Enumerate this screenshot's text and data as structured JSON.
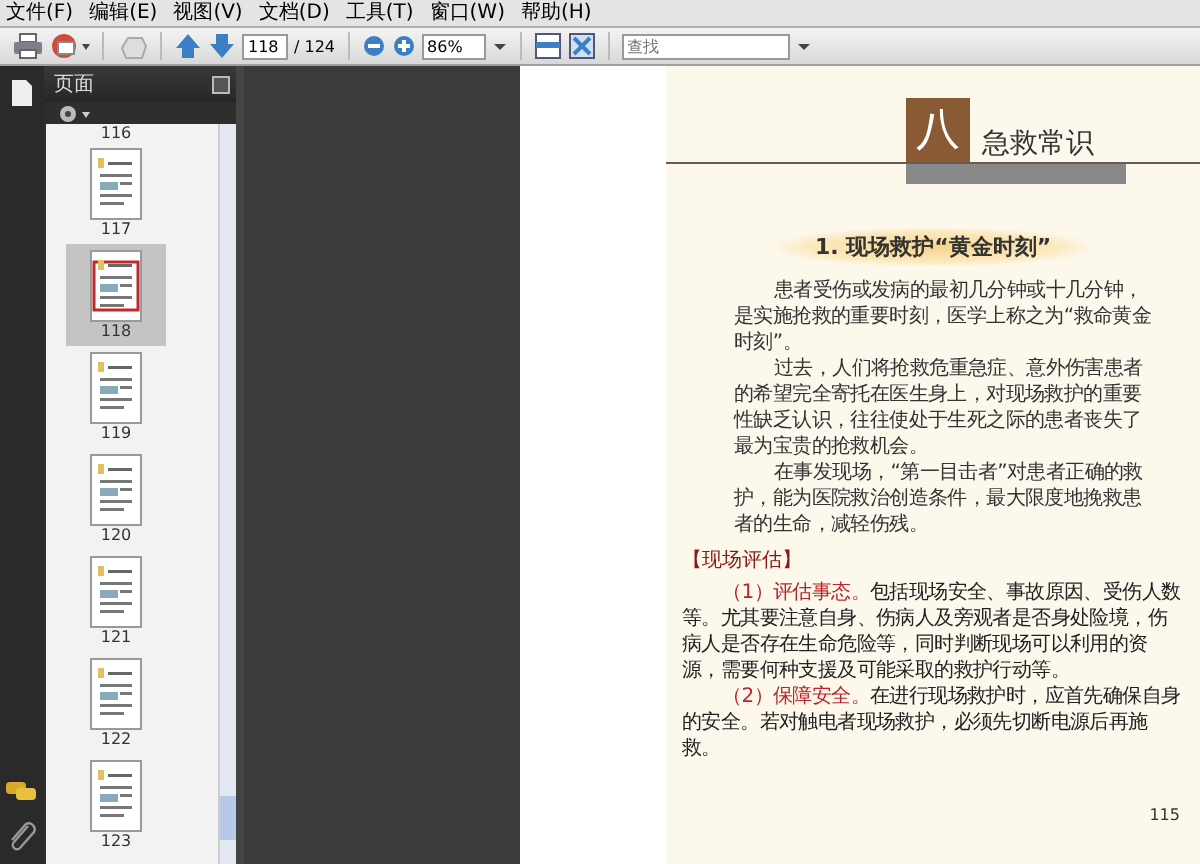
{
  "menu": [
    "文件(F)",
    "编辑(E)",
    "视图(V)",
    "文档(D)",
    "工具(T)",
    "窗口(W)",
    "帮助(H)"
  ],
  "toolbar": {
    "page": "118",
    "page_count": "/ 124",
    "zoom": "86%",
    "search": {
      "placeholder": "查找"
    }
  },
  "sidebar": {
    "title": "页面",
    "thumbnails": [
      {
        "label": "116",
        "selected": false
      },
      {
        "label": "117",
        "selected": false
      },
      {
        "label": "118",
        "selected": true
      },
      {
        "label": "119",
        "selected": false
      },
      {
        "label": "120",
        "selected": false
      },
      {
        "label": "121",
        "selected": false
      },
      {
        "label": "122",
        "selected": false
      },
      {
        "label": "123",
        "selected": false
      }
    ]
  },
  "document": {
    "chapter_number": "八",
    "chapter_title": "急救常识",
    "section_title": "1. 现场救护“黄金时刻”",
    "paragraphs": [
      "患者受伤或发病的最初几分钟或十几分钟，是实施抢救的重要时刻，医学上称之为“救命黄金时刻”。",
      "过去，人们将抢救危重急症、意外伤害患者的希望完全寄托在医生身上，对现场救护的重要性缺乏认识，往往使处于生死之际的患者丧失了最为宝贵的抢救机会。",
      "在事发现场，“第一目击者”对患者正确的救护，能为医院救治创造条件，最大限度地挽救患者的生命，减轻伤残。"
    ],
    "subheading": "【现场评估】",
    "items": [
      {
        "lead": "（1）评估事态。",
        "text": "包括现场安全、事故原因、受伤人数等。尤其要注意自身、伤病人及旁观者是否身处险境，伤病人是否存在生命危险等，同时判断现场可以利用的资源，需要何种支援及可能采取的救护行动等。"
      },
      {
        "lead": "（2）保障安全。",
        "text": "在进行现场救护时，应首先确保自身的安全。若对触电者现场救护，必须先切断电源后再施救。"
      }
    ],
    "page_number": "115"
  }
}
